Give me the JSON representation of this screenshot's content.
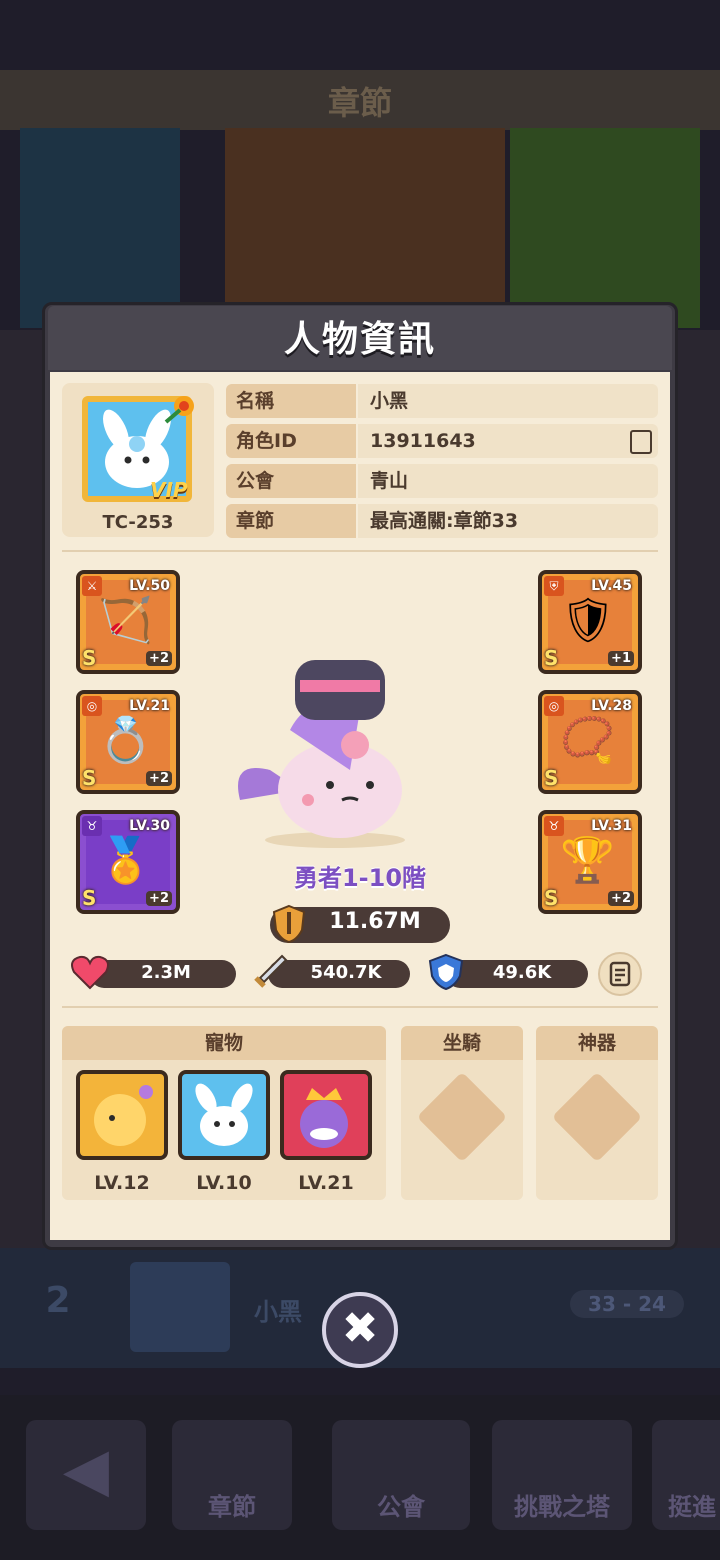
{
  "background": {
    "header_title": "章節",
    "rank_number": "2",
    "player_name": "小黑",
    "stage": "33 - 24",
    "nav": [
      "章節",
      "公會",
      "挑戰之塔",
      "挺進"
    ]
  },
  "modal": {
    "title": "人物資訊",
    "profile": {
      "avatar_id": "TC-253",
      "vip_label": "VIP",
      "rows": [
        {
          "key": "名稱",
          "value": "小黑"
        },
        {
          "key": "角色ID",
          "value": "13911643"
        },
        {
          "key": "公會",
          "value": "青山"
        },
        {
          "key": "章節",
          "value": "最高通關:章節33"
        }
      ]
    },
    "equipment_left": [
      {
        "level": "LV.50",
        "rank": "S",
        "plus": "+2",
        "icon": "bow-icon"
      },
      {
        "level": "LV.21",
        "rank": "S",
        "plus": "+2",
        "icon": "ring-icon"
      },
      {
        "level": "LV.30",
        "rank": "S",
        "plus": "+2",
        "icon": "medal-icon",
        "color": "purple"
      }
    ],
    "equipment_right": [
      {
        "level": "LV.45",
        "rank": "S",
        "plus": "+1",
        "icon": "armor-icon"
      },
      {
        "level": "LV.28",
        "rank": "S",
        "plus": "",
        "icon": "bracelet-icon"
      },
      {
        "level": "LV.31",
        "rank": "S",
        "plus": "+2",
        "icon": "chalice-icon"
      }
    ],
    "hero_title": "勇者1-10階",
    "power": "11.67M",
    "stats": {
      "hp": "2.3M",
      "attack": "540.7K",
      "defense": "49.6K"
    },
    "sections": {
      "pets_label": "寵物",
      "mount_label": "坐騎",
      "artifact_label": "神器",
      "pets": [
        {
          "level": "LV.12",
          "color": "#f3b43a",
          "icon": "pet-lion-icon"
        },
        {
          "level": "LV.10",
          "color": "#5ec0ee",
          "icon": "pet-bunny-icon"
        },
        {
          "level": "LV.21",
          "color": "#e0405a",
          "icon": "pet-king-icon"
        }
      ]
    }
  }
}
